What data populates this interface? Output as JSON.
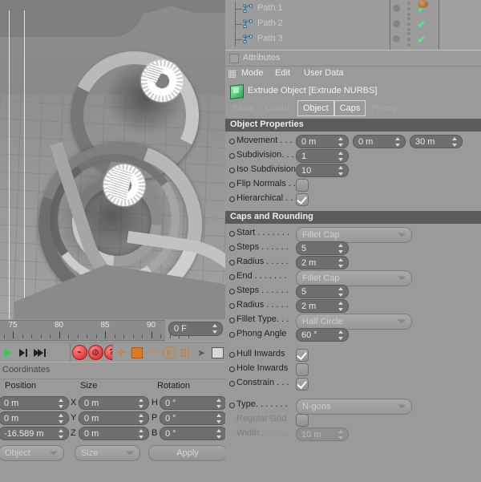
{
  "app": "Cinema 4D",
  "object_manager": {
    "rows": [
      {
        "label": "Path 1",
        "icon": "spline-icon",
        "check": "✔"
      },
      {
        "label": "Path 2",
        "icon": "spline-icon",
        "check": "✔"
      },
      {
        "label": "Path 3",
        "icon": "spline-icon",
        "check": "✔"
      }
    ]
  },
  "attributes": {
    "title": "Attributes",
    "menu": [
      "Mode",
      "Edit",
      "User Data"
    ],
    "object_header": "Extrude Object [Extrude NURBS]",
    "tabs": [
      {
        "label": "Basic",
        "active": false
      },
      {
        "label": "Coord.",
        "active": false
      },
      {
        "label": "Object",
        "active": true
      },
      {
        "label": "Caps",
        "active": true
      },
      {
        "label": "Phong",
        "active": false
      }
    ],
    "sections": [
      {
        "title": "Object Properties",
        "rows": [
          {
            "label": "Movement . . .",
            "type": "triple",
            "values": [
              "0 m",
              "0 m",
              "30 m"
            ]
          },
          {
            "label": "Subdivision. . .",
            "type": "number",
            "value": "1"
          },
          {
            "label": "Iso Subdivision",
            "type": "number",
            "value": "10"
          },
          {
            "label": "Flip Normals . .",
            "type": "check",
            "value": false
          },
          {
            "label": "Hierarchical . .",
            "type": "check",
            "value": true
          }
        ]
      },
      {
        "title": "Caps and Rounding",
        "rows": [
          {
            "label": "Start . . . . . . .",
            "type": "select",
            "value": "Fillet Cap"
          },
          {
            "label": "Steps . . . . . .",
            "type": "number",
            "value": "5"
          },
          {
            "label": "Radius . . . . .",
            "type": "number",
            "value": "2 m"
          },
          {
            "label": "End . . . . . . .",
            "type": "select",
            "value": "Fillet Cap"
          },
          {
            "label": "Steps . . . . . .",
            "type": "number",
            "value": "5"
          },
          {
            "label": "Radius . . . . .",
            "type": "number",
            "value": "2 m"
          },
          {
            "label": "Fillet Type. . .",
            "type": "select",
            "value": "Half Circle"
          },
          {
            "label": "Phong Angle",
            "type": "number",
            "value": "60 °"
          },
          {
            "label": "Hull Inwards",
            "type": "check",
            "value": true
          },
          {
            "label": "Hole Inwards",
            "type": "check",
            "value": false
          },
          {
            "label": "Constrain . . .",
            "type": "check",
            "value": true
          },
          {
            "label": "Type. . . . . . .",
            "type": "select",
            "value": "N-gons"
          },
          {
            "label": "Regular Grid",
            "type": "check",
            "value": false,
            "disabled": true
          },
          {
            "label": "Width . . . . . .",
            "type": "number",
            "value": "10 m",
            "disabled": true
          }
        ]
      }
    ]
  },
  "timeline": {
    "ticks": [
      "75",
      "80",
      "85",
      "90"
    ],
    "frame_field": "0 F"
  },
  "toolbar": {
    "transport": [
      "play-icon",
      "step-forward-icon",
      "go-to-end-icon"
    ],
    "record": [
      "record-key-icon",
      "autokey-icon",
      "key-help-icon"
    ],
    "tools": [
      "move-icon",
      "scale-icon",
      "rotate-icon",
      "parametric-icon",
      "grid-snap-icon",
      "magnet-icon",
      "layout-icon"
    ]
  },
  "coordinates": {
    "title": "Coordinates",
    "columns": [
      "Position",
      "Size",
      "Rotation"
    ],
    "position": [
      {
        "axis": "",
        "value": "0 m"
      },
      {
        "axis": "",
        "value": "0 m"
      },
      {
        "axis": "",
        "value": "-16.589 m"
      }
    ],
    "size": [
      {
        "axis": "X",
        "value": "0 m"
      },
      {
        "axis": "Y",
        "value": "0 m"
      },
      {
        "axis": "Z",
        "value": "0 m"
      }
    ],
    "rotation": [
      {
        "axis": "H",
        "value": "0 °"
      },
      {
        "axis": "P",
        "value": "0 °"
      },
      {
        "axis": "B",
        "value": "0 °"
      }
    ],
    "mode_select": "Object",
    "size_select": "Size",
    "apply_button": "Apply"
  },
  "colors": {
    "panel_bg": "#9a9a9a",
    "section_header": "#5b5b5b",
    "field_bg": "#6f6f6f",
    "green_check": "#43f08a",
    "accent_orange": "#e07820",
    "accent_red": "#e03a3a"
  }
}
